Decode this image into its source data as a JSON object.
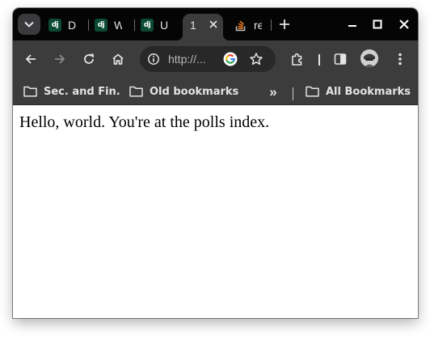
{
  "colors": {
    "tabstrip": "#050505",
    "toolbar": "#3c3c3c",
    "omnibox": "#282828",
    "django_favicon": "#0c4b33",
    "stackoverflow_orange": "#f48024",
    "text_light": "#e3e3e3"
  },
  "tabs": [
    {
      "favicon": "django-icon",
      "favicon_text": "dj",
      "title": "D"
    },
    {
      "favicon": "django-icon",
      "favicon_text": "dj",
      "title": "W"
    },
    {
      "favicon": "django-icon",
      "favicon_text": "dj",
      "title": "U"
    },
    {
      "title": "1",
      "active": true
    },
    {
      "favicon": "stackoverflow-icon",
      "title": "re"
    }
  ],
  "toolbar": {
    "url": "http://...",
    "icons": [
      "back-arrow-icon",
      "forward-arrow-icon",
      "reload-icon",
      "home-icon",
      "site-info-icon",
      "google-icon",
      "bookmark-star-icon",
      "extensions-icon",
      "side-panel-icon",
      "profile-avatar",
      "more-menu-icon"
    ]
  },
  "bookmarks": {
    "items": [
      {
        "label": "Sec. and Fin.",
        "icon": "folder-icon"
      },
      {
        "label": "Old bookmarks",
        "icon": "folder-icon"
      }
    ],
    "overflow": "»",
    "all_bookmarks": {
      "label": "All Bookmarks",
      "icon": "folder-icon"
    }
  },
  "page": {
    "text": "Hello, world. You're at the polls index."
  }
}
